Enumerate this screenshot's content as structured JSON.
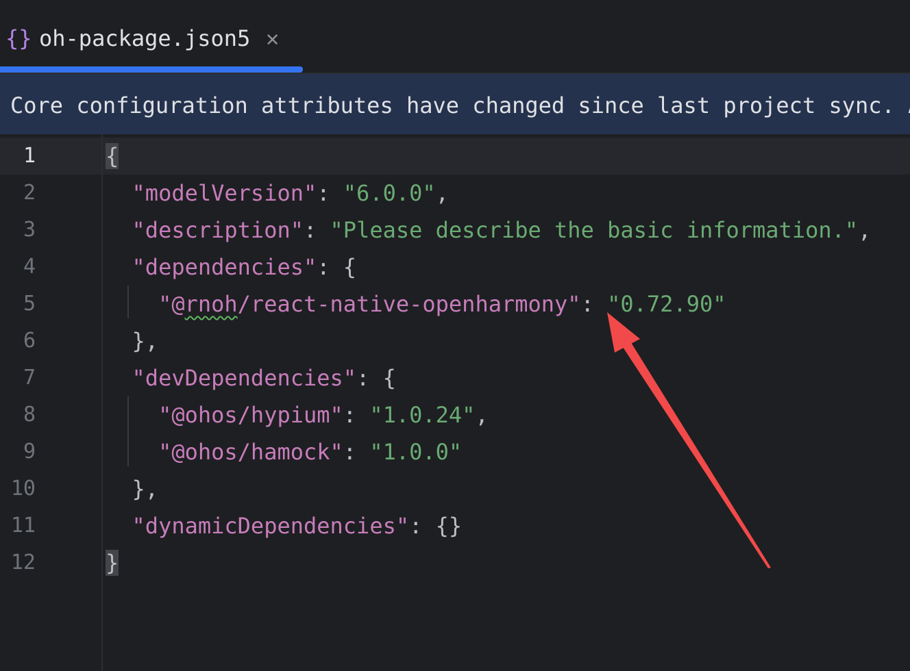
{
  "tab": {
    "icon": "{}",
    "title": "oh-package.json5",
    "close_glyph": "✕"
  },
  "banner": {
    "text": "Core configuration attributes have changed since last project sync. A"
  },
  "editor": {
    "line_numbers": [
      "1",
      "2",
      "3",
      "4",
      "5",
      "6",
      "7",
      "8",
      "9",
      "10",
      "11",
      "12"
    ],
    "lines": [
      {
        "t": "brace_open",
        "text": "{"
      },
      {
        "t": "kv",
        "indent": "  ",
        "key": "\"modelVersion\"",
        "sep": ": ",
        "val": "\"6.0.0\"",
        "end": ","
      },
      {
        "t": "kv",
        "indent": "  ",
        "key": "\"description\"",
        "sep": ": ",
        "val": "\"Please describe the basic information.\"",
        "end": ","
      },
      {
        "t": "kopen",
        "indent": "  ",
        "key": "\"dependencies\"",
        "sep": ": ",
        "end": "{"
      },
      {
        "t": "kv5",
        "indent": "    ",
        "key_a": "\"@",
        "key_sq": "rnoh",
        "key_b": "/react-native-openharmony\"",
        "sep": ": ",
        "val": "\"0.72.90\"",
        "end": ""
      },
      {
        "t": "plain",
        "indent": "  ",
        "text": "},"
      },
      {
        "t": "kopen",
        "indent": "  ",
        "key": "\"devDependencies\"",
        "sep": ": ",
        "end": "{"
      },
      {
        "t": "kv",
        "indent": "    ",
        "key": "\"@ohos/hypium\"",
        "sep": ": ",
        "val": "\"1.0.24\"",
        "end": ","
      },
      {
        "t": "kv",
        "indent": "    ",
        "key": "\"@ohos/hamock\"",
        "sep": ": ",
        "val": "\"1.0.0\"",
        "end": ""
      },
      {
        "t": "plain",
        "indent": "  ",
        "text": "},"
      },
      {
        "t": "kopen",
        "indent": "  ",
        "key": "\"dynamicDependencies\"",
        "sep": ": ",
        "end": "{}"
      },
      {
        "t": "brace_close",
        "text": "}"
      }
    ]
  },
  "colors": {
    "accent": "#3574f0",
    "annotation_arrow": "#f24a4a"
  }
}
